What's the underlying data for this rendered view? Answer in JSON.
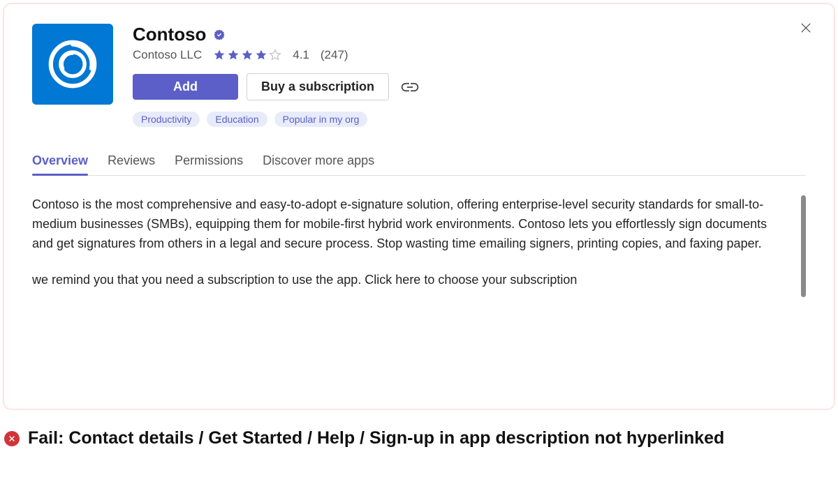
{
  "app": {
    "title": "Contoso",
    "publisher": "Contoso LLC",
    "rating_value": "4.1",
    "rating_count": "(247)",
    "stars_filled": 4,
    "add_label": "Add",
    "subscribe_label": "Buy a subscription",
    "tags": [
      "Productivity",
      "Education",
      "Popular in my org"
    ]
  },
  "tabs": {
    "items": [
      "Overview",
      "Reviews",
      "Permissions",
      "Discover more apps"
    ],
    "active_index": 0
  },
  "content": {
    "p1": "Contoso is the most comprehensive and easy-to-adopt e-signature solution, offering enterprise-level security standards for small-to-medium businesses (SMBs), equipping them for mobile-first hybrid work environments. Contoso lets you effortlessly sign documents and get signatures from others in a legal and secure process. Stop wasting time emailing signers, printing copies, and faxing paper.",
    "p2": "we remind you that  you need a subscription to use the app. Click here to choose your subscription"
  },
  "footer": {
    "fail_text": "Fail: Contact details / Get Started / Help / Sign-up in app description not hyperlinked"
  }
}
